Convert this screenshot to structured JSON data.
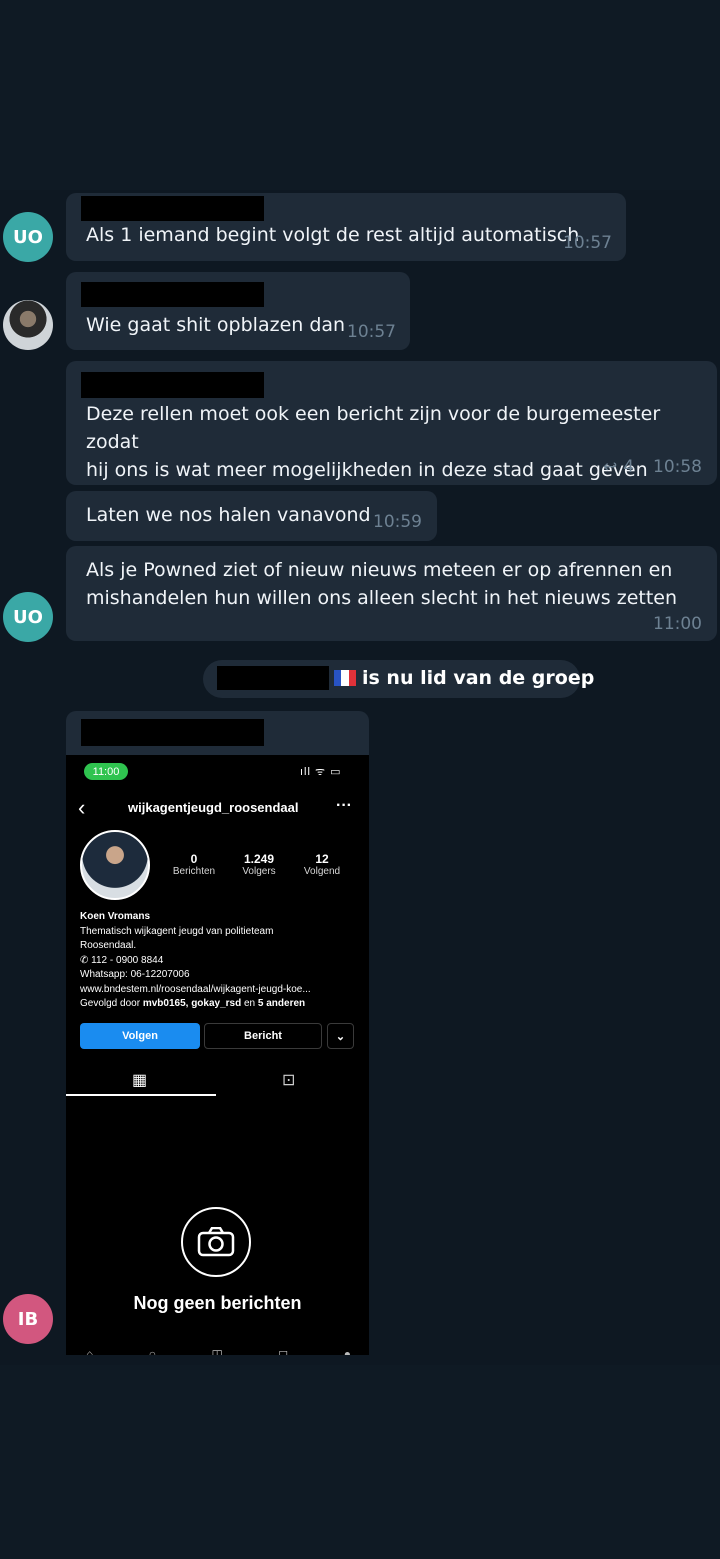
{
  "messages": [
    {
      "avatar": "UO",
      "text": "Als 1 iemand begint volgt de rest altijd automatisch",
      "time": "10:57"
    },
    {
      "avatar_icon": "user-photo",
      "text": "Wie gaat shit opblazen dan",
      "time": "10:57"
    },
    {
      "text": "Deze rellen moet ook een bericht zijn voor de burgemeester zodat\nhij ons is wat meer mogelijkheden in deze stad gaat geven",
      "time": "10:58",
      "replies": "4"
    },
    {
      "text": "Laten we nos halen vanavond",
      "time": "10:59"
    },
    {
      "avatar": "UO",
      "text": "Als je Powned ziet of nieuw nieuws meteen er op afrennen en\nmishandelen hun willen ons alleen slecht in het nieuws zetten",
      "time": "11:00"
    }
  ],
  "system": {
    "text": "is nu lid van de groep"
  },
  "photo_sender": {
    "avatar": "IB"
  },
  "colors": {
    "avatar_uo": "#3aa8a6",
    "avatar_ib": "#d2577f",
    "bubble": "#1f2b38",
    "background": "#0f1a24",
    "instagram_blue": "#1a8cf0"
  },
  "instagram": {
    "status_time": "11:00",
    "status_icons": "ıll ᯤ ▭",
    "username": "wijkagentjeugd_roosendaal",
    "stats": [
      {
        "value": "0",
        "label": "Berichten"
      },
      {
        "value": "1.249",
        "label": "Volgers"
      },
      {
        "value": "12",
        "label": "Volgend"
      }
    ],
    "bio": {
      "name": "Koen Vromans",
      "line1": "Thematisch wijkagent jeugd van politieteam",
      "line2": "Roosendaal.",
      "phone": "112 - 0900 8844",
      "whatsapp": "Whatsapp: 06-12207006",
      "link": "www.bndestem.nl/roosendaal/wijkagent-jeugd-koe...",
      "followed_prefix": "Gevolgd door",
      "followed_names": "mvb0165, gokay_rsd",
      "followed_mid": "en",
      "followed_others": "5 anderen"
    },
    "follow_button": "Volgen",
    "message_button": "Bericht",
    "dropdown_glyph": "⌄",
    "grid_icon": "grid-icon",
    "tagged_icon": "tagged-icon",
    "empty_text": "Nog geen berichten"
  }
}
